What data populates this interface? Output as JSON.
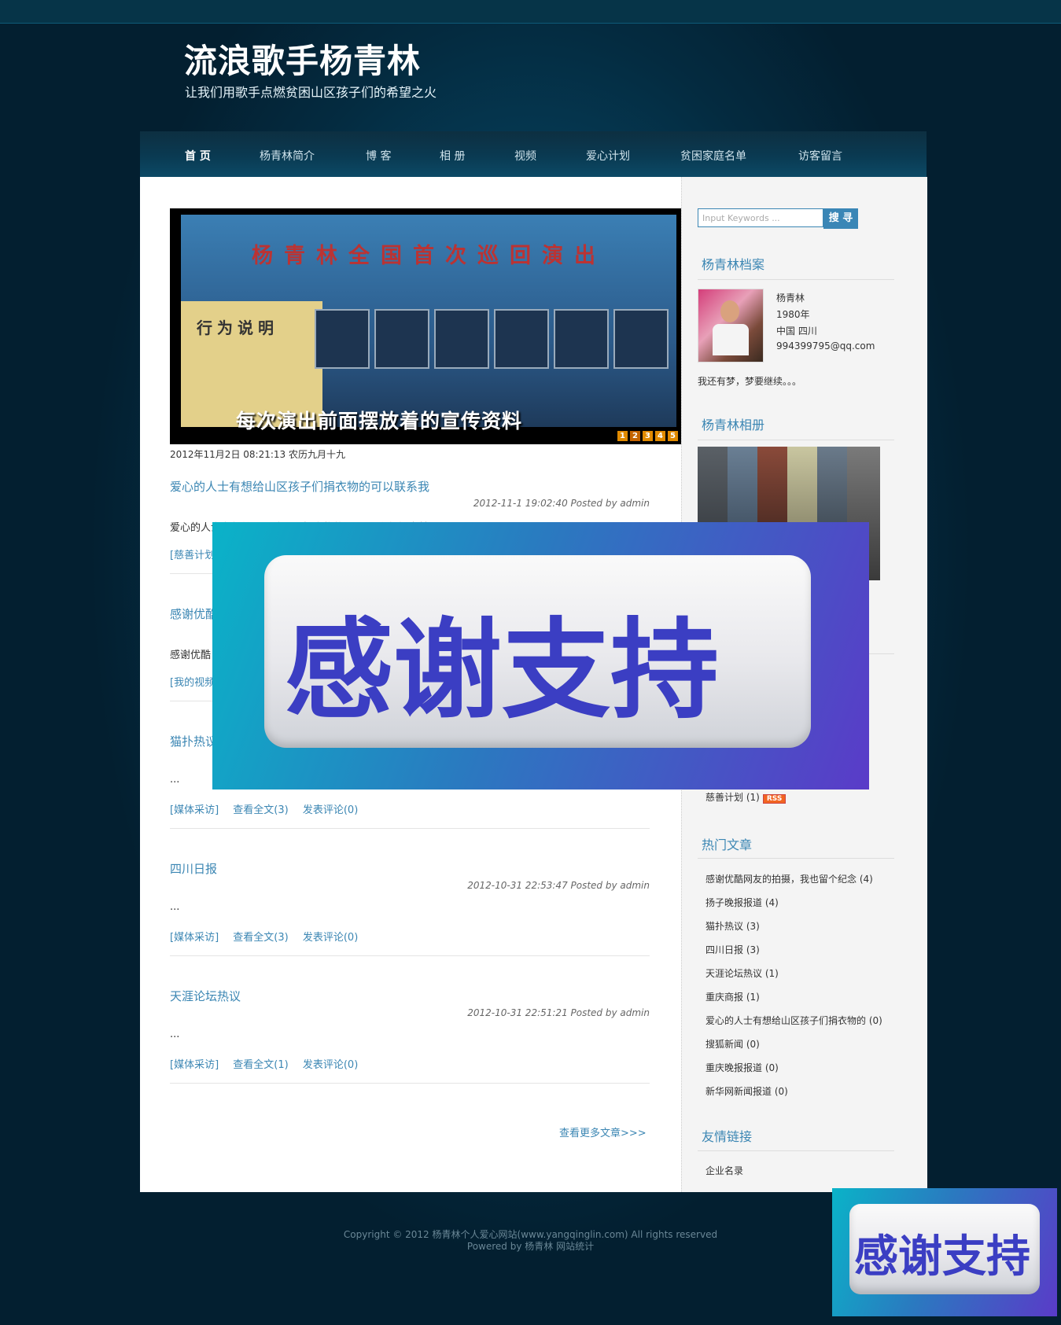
{
  "header": {
    "site_title": "流浪歌手杨青林",
    "subtitle": "让我们用歌手点燃贫困山区孩子们的希望之火"
  },
  "nav": {
    "items": [
      "首 页",
      "杨青林简介",
      "博 客",
      "相 册",
      "视频",
      "爱心计划",
      "贫困家庭名单",
      "访客留言"
    ]
  },
  "slideshow": {
    "banner": "杨青林全国首次巡回演出",
    "sign": "行为说明",
    "caption": "每次演出前面摆放着的宣传资料",
    "pages": [
      "1",
      "2",
      "3",
      "4",
      "5"
    ],
    "current_page": "2"
  },
  "date_line": "2012年11月2日 08:21:13 农历九月十九",
  "posts": [
    {
      "title": "爱心的人士有想给山区孩子们捐衣物的可以联系我",
      "meta": "2012-11-1 19:02:40  Posted by admin",
      "excerpt": "爱心的人士有想给山区孩子们捐衣物的可以联系我 杨青林 QQ：994399795",
      "category": "[慈善计划]",
      "read": "",
      "comment": ""
    },
    {
      "title": "感谢优酷",
      "meta": "",
      "excerpt": "感谢优酷",
      "category": "[我的视频]",
      "read": "",
      "comment": ""
    },
    {
      "title": "猫扑热议",
      "meta": "",
      "excerpt": "...",
      "category": "[媒体采访]",
      "read": "查看全文(3)",
      "comment": "发表评论(0)"
    },
    {
      "title": "四川日报",
      "meta": "2012-10-31 22:53:47  Posted by admin",
      "excerpt": "...",
      "category": "[媒体采访]",
      "read": "查看全文(3)",
      "comment": "发表评论(0)"
    },
    {
      "title": "天涯论坛热议",
      "meta": "2012-10-31 22:51:21  Posted by admin",
      "excerpt": "...",
      "category": "[媒体采访]",
      "read": "查看全文(1)",
      "comment": "发表评论(0)"
    }
  ],
  "more_link": "查看更多文章>>>",
  "search": {
    "placeholder": "Input Keywords ...",
    "button": "搜 寻"
  },
  "profile": {
    "heading": "杨青林档案",
    "name": "杨青林",
    "year": "1980年",
    "location": "中国 四川",
    "email": "994399795@qq.com",
    "motto": "我还有梦，梦要继续。。。"
  },
  "album": {
    "heading": "杨青林相册"
  },
  "categories": {
    "last_item": "慈善计划 (1)",
    "rss": "RSS"
  },
  "hot": {
    "heading": "热门文章",
    "items": [
      "感谢优酷网友的拍摄，我也留个纪念 (4)",
      "扬子晚报报道 (4)",
      "猫扑热议 (3)",
      "四川日报 (3)",
      "天涯论坛热议 (1)",
      "重庆商报 (1)",
      "爱心的人士有想给山区孩子们捐衣物的 (0)",
      "搜狐新闻 (0)",
      "重庆晚报报道 (0)",
      "新华网新闻报道 (0)"
    ]
  },
  "links": {
    "heading": "友情链接",
    "items": [
      "企业名录"
    ]
  },
  "footer": {
    "copyright": "Copyright © 2012 杨青林个人爱心网站(www.yangqinglin.com) All rights reserved",
    "powered": "Powered by 杨青林 网站统计"
  },
  "overlay": {
    "text": "感谢支持"
  },
  "colors": {
    "accent": "#3b86b3",
    "nav_bg": "#0a3a52",
    "overlay_text": "#3b3ec3",
    "rss": "#f26522"
  }
}
